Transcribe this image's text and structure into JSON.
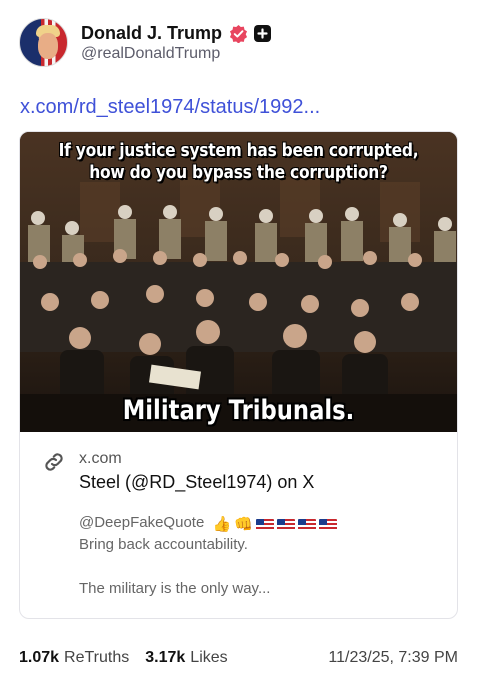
{
  "post": {
    "display_name": "Donald J. Trump",
    "handle": "@realDonaldTrump",
    "link_text": "x.com/rd_steel1974/status/1992...",
    "image": {
      "caption_top_line1": "If your justice system has been corrupted,",
      "caption_top_line2": "how do you bypass the corruption?",
      "caption_bottom": "Military Tribunals."
    },
    "preview": {
      "domain": "x.com",
      "title": "Steel (@RD_Steel1974) on X",
      "quote_handle": "@DeepFakeQuote",
      "line_1": "Bring back accountability.",
      "line_2": "The military is the only way..."
    }
  },
  "stats": {
    "retruths_count": "1.07k",
    "retruths_label": "ReTruths",
    "likes_count": "3.17k",
    "likes_label": "Likes",
    "timestamp": "11/23/25, 7:39 PM"
  },
  "colors": {
    "link": "#3f51d8",
    "verified_badge": "#e8455f"
  },
  "icons": [
    "verified-badge-icon",
    "plus-badge-icon",
    "link-icon"
  ]
}
